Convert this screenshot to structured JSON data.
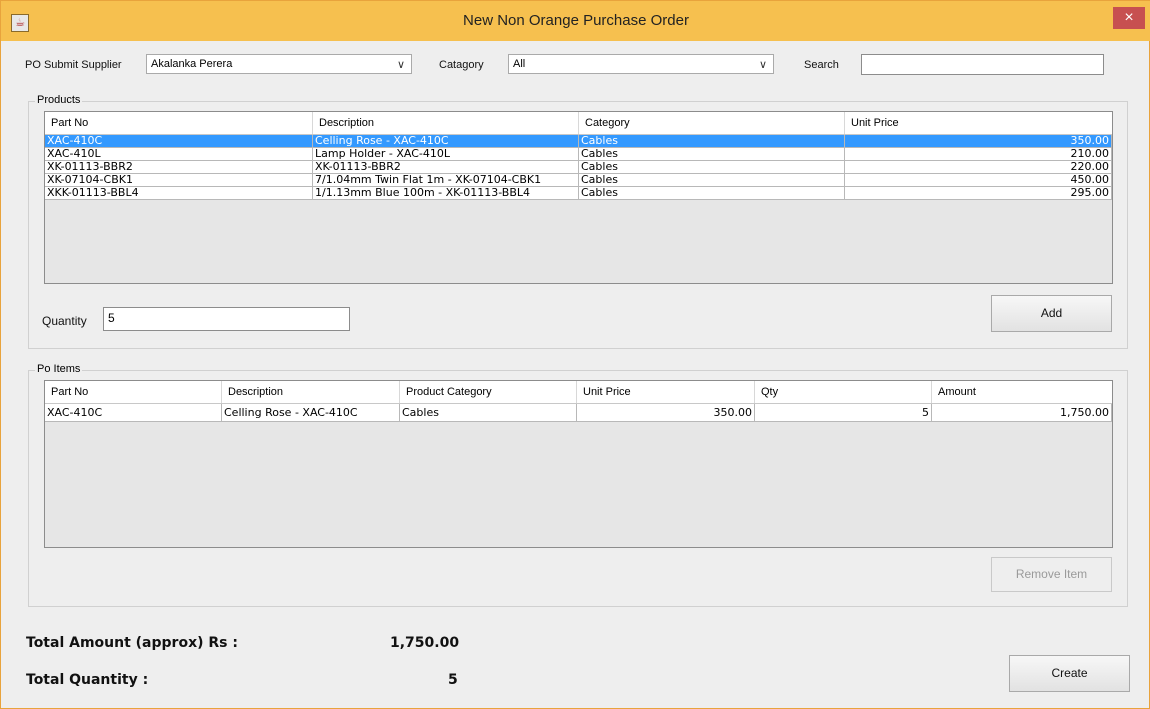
{
  "window": {
    "title": "New Non Orange Purchase Order",
    "close_glyph": "×",
    "app_icon": "java-icon"
  },
  "top": {
    "supplier_label": "PO Submit Supplier",
    "supplier_value": "Akalanka Perera",
    "category_label": "Catagory",
    "category_value": "All",
    "search_label": "Search",
    "search_value": ""
  },
  "products": {
    "group_title": "Products",
    "columns": [
      "Part No",
      "Description",
      "Category",
      "Unit Price"
    ],
    "rows": [
      [
        "XAC-410C",
        "Celling Rose - XAC-410C",
        "Cables",
        "350.00"
      ],
      [
        "XAC-410L",
        "Lamp Holder - XAC-410L",
        "Cables",
        "210.00"
      ],
      [
        "XK-01113-BBR2",
        "XK-01113-BBR2",
        "Cables",
        "220.00"
      ],
      [
        "XK-07104-CBK1",
        "7/1.04mm Twin Flat 1m - XK-07104-CBK1",
        "Cables",
        "450.00"
      ],
      [
        "XKK-01113-BBL4",
        "1/1.13mm Blue 100m - XK-01113-BBL4",
        "Cables",
        "295.00"
      ]
    ],
    "selected_index": 0,
    "quantity_label": "Quantity",
    "quantity_value": "5",
    "add_label": "Add"
  },
  "po_items": {
    "group_title": "Po Items",
    "columns": [
      "Part No",
      "Description",
      "Product Category",
      "Unit Price",
      "Qty",
      "Amount"
    ],
    "rows": [
      [
        "XAC-410C",
        "Celling Rose - XAC-410C",
        "Cables",
        "350.00",
        "5",
        "1,750.00"
      ]
    ],
    "remove_label": "Remove Item"
  },
  "totals": {
    "amount_label": "Total Amount (approx) Rs :",
    "amount_value": "1,750.00",
    "qty_label": "Total Quantity  :",
    "qty_value": "5"
  },
  "create_label": "Create",
  "colors": {
    "titlebar": "#f6c04f",
    "selection": "#3399ff",
    "close": "#c75050"
  }
}
